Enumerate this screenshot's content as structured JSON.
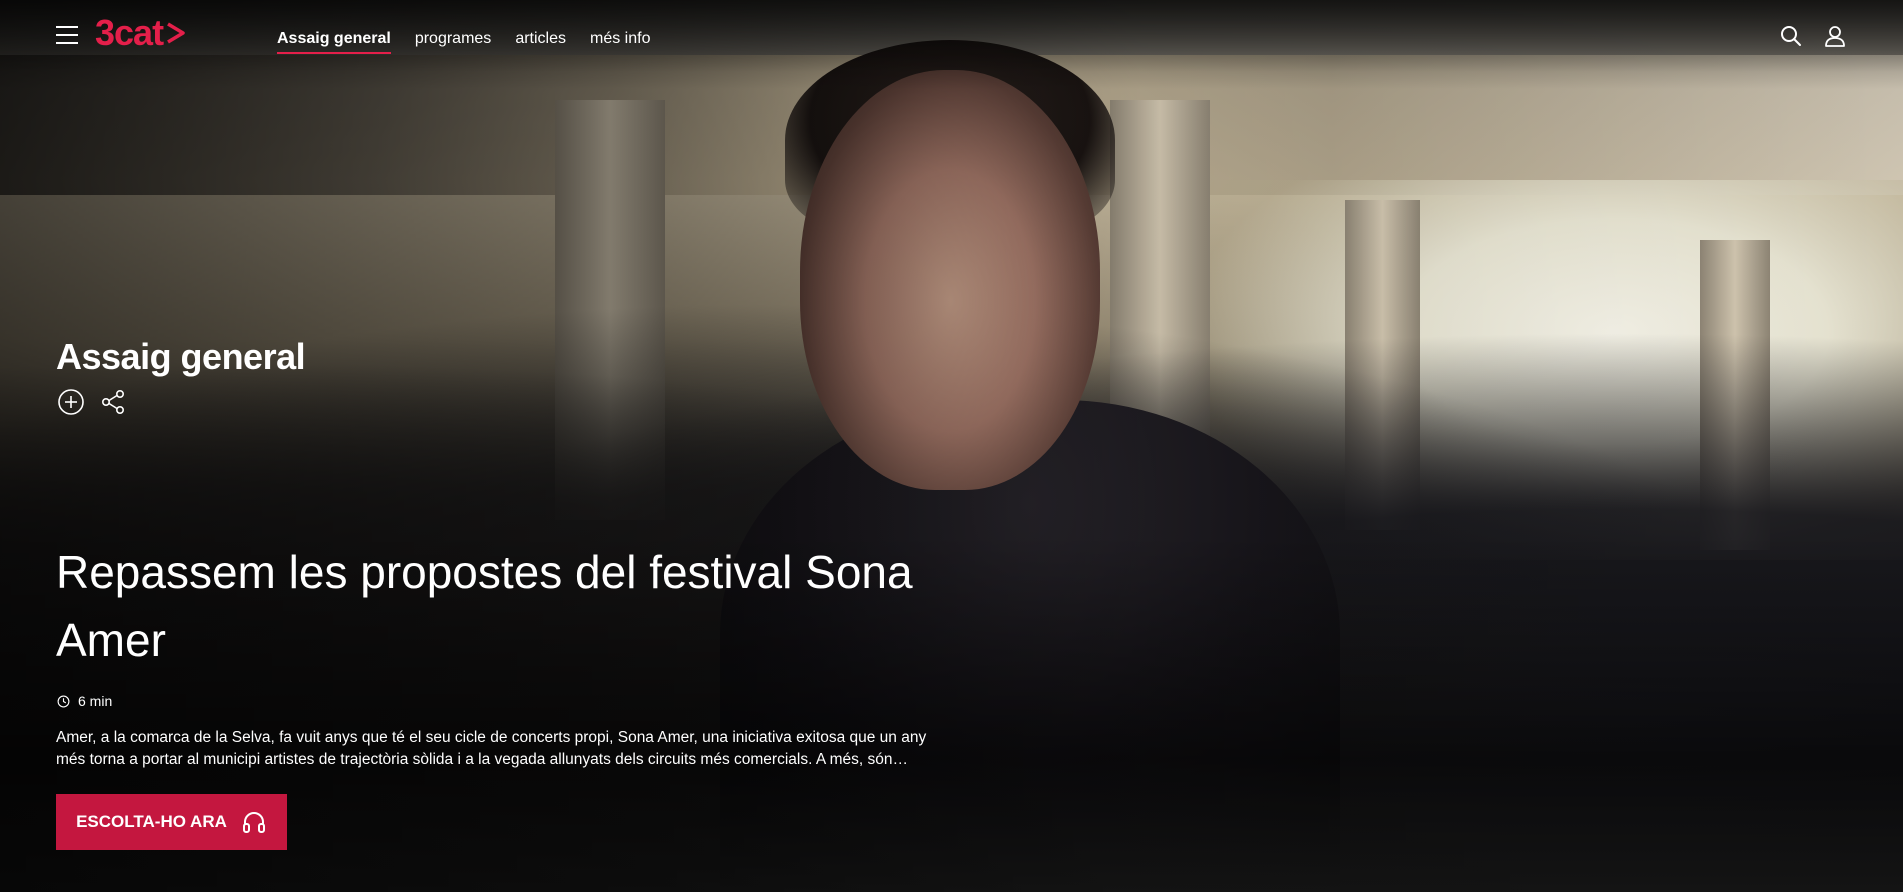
{
  "brand": {
    "logo_text": "3cat",
    "accent": "#e41f4a",
    "cta_color": "#c4173f"
  },
  "nav": {
    "items": [
      {
        "label": "Assaig general",
        "active": true
      },
      {
        "label": "programes",
        "active": false
      },
      {
        "label": "articles",
        "active": false
      },
      {
        "label": "més info",
        "active": false
      }
    ]
  },
  "header_icons": [
    "menu-icon",
    "search-icon",
    "user-icon"
  ],
  "program": {
    "title": "Assaig general",
    "action_icons": [
      "add-circle-icon",
      "share-icon"
    ]
  },
  "episode": {
    "title": "Repassem les propostes del festival Sona Amer",
    "duration": "6 min",
    "description": "Amer, a la comarca de la Selva, fa vuit anys que té el seu cicle de concerts propi, Sona Amer, una iniciativa exitosa que un any més torna a portar al municipi artistes de trajectòria sòlida i a la vegada allunyats dels circuits més comercials. A més, són…",
    "cta_label": "ESCOLTA-HO ARA",
    "cta_icon": "headphones-icon"
  }
}
